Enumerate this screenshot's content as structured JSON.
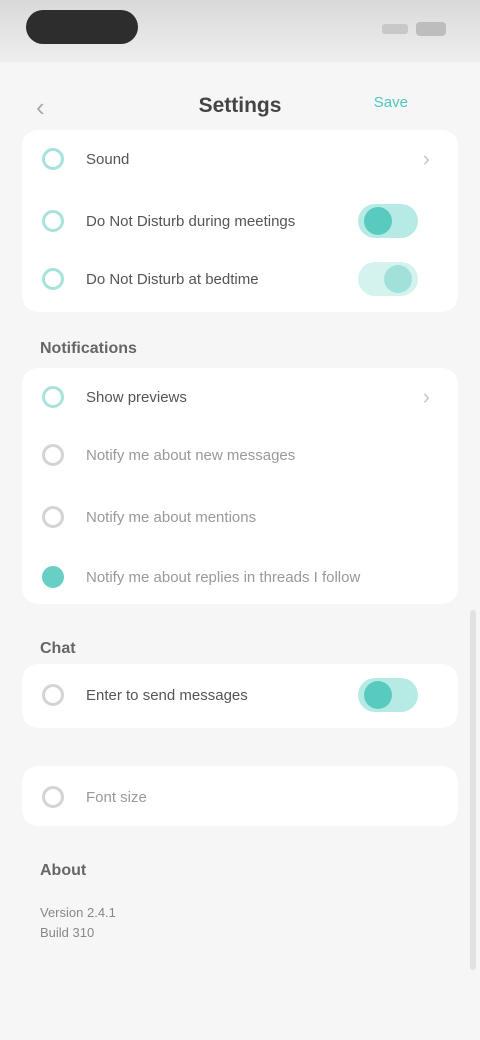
{
  "header": {
    "title": "Settings",
    "back_glyph": "‹",
    "action_label": "Save"
  },
  "section_1": {
    "items": [
      {
        "label": "Sound",
        "icon": "sound-icon",
        "kind": "chevron"
      },
      {
        "label": "Do Not Disturb during meetings",
        "icon": "moon-icon",
        "kind": "toggle",
        "on": true
      },
      {
        "label": "Do Not Disturb at bedtime",
        "icon": "clock-icon",
        "kind": "toggle",
        "on": true
      }
    ]
  },
  "section_2": {
    "title": "Notifications",
    "items": [
      {
        "label": "Show previews",
        "icon": "eye-icon",
        "kind": "chevron"
      },
      {
        "label": "Notify me about new messages",
        "icon": "bell-icon",
        "kind": "none"
      },
      {
        "label": "Notify me about mentions",
        "icon": "at-icon",
        "kind": "none"
      },
      {
        "label": "Notify me about replies in threads I follow",
        "icon": "thread-icon",
        "kind": "none"
      }
    ]
  },
  "section_3": {
    "title": "Chat",
    "items": [
      {
        "label": "Enter to send messages",
        "icon": "keyboard-icon",
        "kind": "toggle",
        "on": true
      }
    ]
  },
  "section_4": {
    "items": [
      {
        "label": "Font size",
        "icon": "text-size-icon",
        "kind": "none"
      }
    ]
  },
  "section_5": {
    "title": "About",
    "footnote_line1": "Version 2.4.1",
    "footnote_line2": "Build 310"
  },
  "colors": {
    "accent": "#58cbbe",
    "background": "#f6f6f6",
    "card": "#ffffff"
  }
}
